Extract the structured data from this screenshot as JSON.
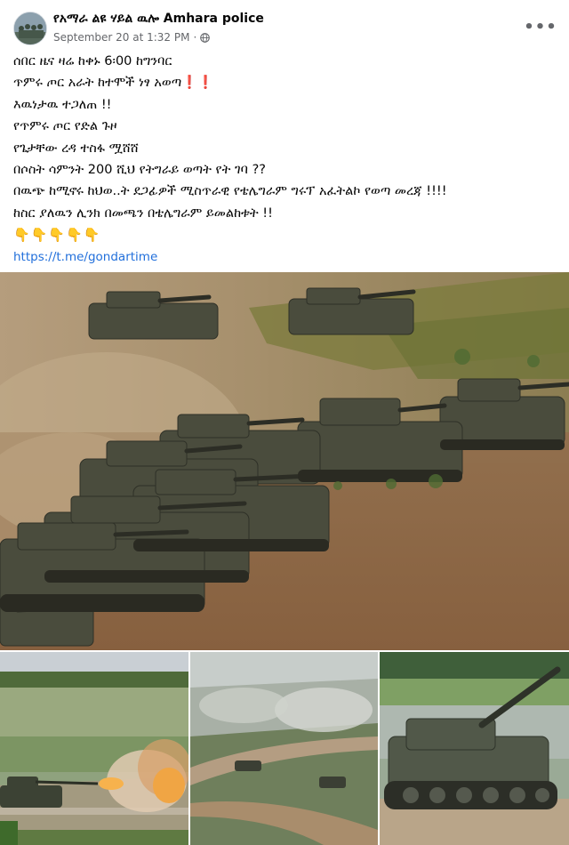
{
  "post": {
    "page_name": "የአማራ ልዩ ሃይል ዉሎ Amhara police",
    "timestamp": "September 20 at 1:32 PM",
    "separator": "·",
    "more_label": "•••",
    "lines": [
      "ሰበር ዜና ዛሬ ከቀኑ 6፡00 ከግንባር",
      " ጥምሩ ጦር አራት ከተሞች ነፃ አወጣ",
      "እዉነታዉ ተጋለጠ  !!",
      "የጥምሩ ጦር የድል ጉዞ",
      "የጌታቸው ረዳ ተስፋ ሟሸሸ",
      "በሶስት ሳምንት 200 ሺህ የትግራይ ወጣት የት ገባ ??",
      "በዉጭ ከሚኖሩ ከህወ..ት ደጋፊዎች ሚስጥራዊ የቴሌግራም ግሩፕ አፈትልኮ የወጣ መረጃ !!!!",
      "ከስር ያለዉን ሊንክ በመጫን  በቴሌግራም ይመልከቱት !!"
    ],
    "alert_marks": "❗❗",
    "pointing_hands": "👇👇👇👇👇",
    "link_text": "https://t.me/gondartime"
  },
  "icons": {
    "globe": "globe-icon",
    "more": "more-options-icon",
    "alert": "exclamation-icon",
    "hands": "pointing-down-icon"
  },
  "colors": {
    "link": "#216fdb",
    "meta": "#65676b",
    "alert": "#d8232a"
  }
}
